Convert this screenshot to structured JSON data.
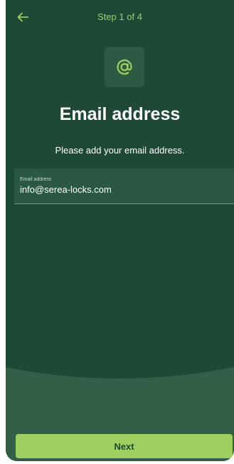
{
  "header": {
    "step_label": "Step 1 of 4",
    "back_icon": "arrow-left-icon"
  },
  "badge": {
    "icon": "at-sign-icon"
  },
  "title": "Email address",
  "subtitle": "Please add your email address.",
  "email_field": {
    "label": "Email address",
    "value": "info@serea-locks.com"
  },
  "next_button": {
    "label": "Next"
  },
  "colors": {
    "background": "#1e4a35",
    "accent": "#9fce61",
    "lower_panel": "#355e48"
  }
}
